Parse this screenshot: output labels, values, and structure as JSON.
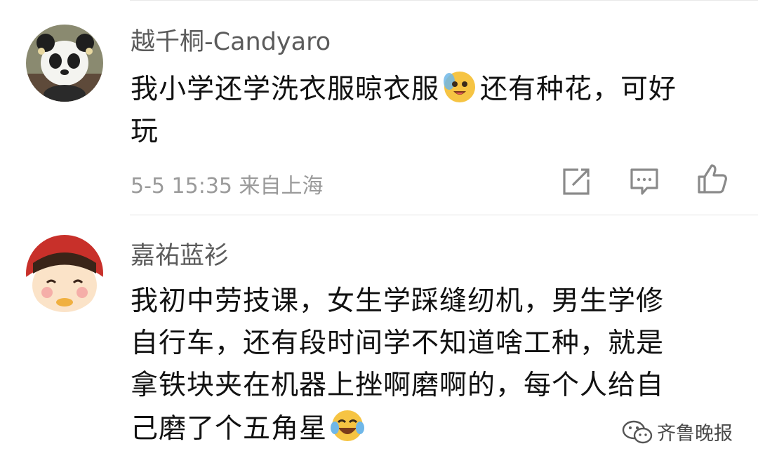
{
  "comments": [
    {
      "username": "越千桐-Candyaro",
      "lines": [
        "我小学还学洗衣服晾衣服",
        "还有种花，可好",
        "玩"
      ],
      "emoji": "sweat-smile-emoji",
      "meta": "5-5 15:35 来自上海",
      "actions": [
        "share-icon",
        "comment-icon",
        "like-icon"
      ]
    },
    {
      "username": "嘉祐蓝衫",
      "lines": [
        "我初中劳技课，女生学踩缝纫机，男生学修",
        "自行车，还有段时间学不知道啥工种，就是",
        "拿铁块夹在机器上挫啊磨啊的，每个人给自",
        "己磨了个五角星"
      ],
      "emoji": "laugh-cry-emoji"
    }
  ],
  "watermark": {
    "text": "齐鲁晚报"
  },
  "colors": {
    "username": "#5b5b5b",
    "meta": "#9a9a9a",
    "icon": "#8a8a8a",
    "divider": "#e4e4e4"
  }
}
